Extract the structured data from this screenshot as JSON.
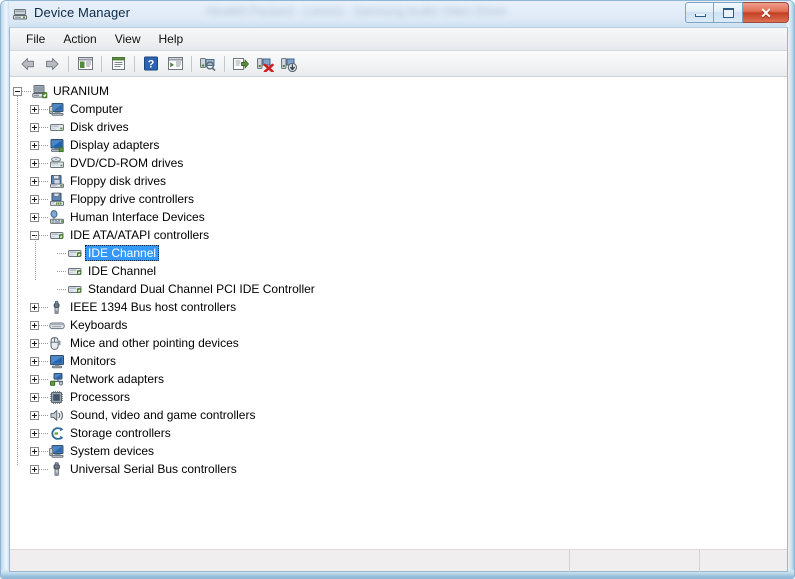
{
  "window": {
    "title": "Device Manager",
    "title_icon": "device-manager-icon",
    "ghost_text": "Hewlett Packard - Lenovo - Samsung Audio Video Driver",
    "controls": {
      "minimize_label": "Minimize",
      "maximize_label": "Maximize",
      "close_label": "✕"
    }
  },
  "menubar": {
    "items": [
      {
        "label": "File"
      },
      {
        "label": "Action"
      },
      {
        "label": "View"
      },
      {
        "label": "Help"
      }
    ]
  },
  "toolbar": {
    "buttons": [
      {
        "name": "back-button",
        "icon": "arrow-left-icon",
        "tooltip": "Back"
      },
      {
        "name": "forward-button",
        "icon": "arrow-right-icon",
        "tooltip": "Forward"
      },
      {
        "name": "show-console-tree-button",
        "icon": "console-tree-icon",
        "tooltip": "Show/Hide Console Tree"
      },
      {
        "name": "properties-button",
        "icon": "properties-icon",
        "tooltip": "Properties"
      },
      {
        "name": "help-button",
        "icon": "help-question-icon",
        "tooltip": "Help"
      },
      {
        "name": "show-hidden-devices-button",
        "icon": "pane-view-icon",
        "tooltip": "View"
      },
      {
        "name": "scan-hardware-changes-button",
        "icon": "scan-hardware-icon",
        "tooltip": "Scan for hardware changes"
      },
      {
        "name": "update-driver-button",
        "icon": "update-driver-icon",
        "tooltip": "Update Driver Software"
      },
      {
        "name": "uninstall-device-button",
        "icon": "uninstall-device-icon",
        "tooltip": "Uninstall"
      },
      {
        "name": "disable-device-button",
        "icon": "disable-device-icon",
        "tooltip": "Disable"
      }
    ]
  },
  "tree": {
    "root": {
      "label": "URANIUM",
      "icon": "computer-root-icon",
      "expanded": true
    },
    "nodes": [
      {
        "label": "Computer",
        "icon": "computer-icon",
        "level": 1,
        "expandable": true,
        "expanded": false,
        "selected": false
      },
      {
        "label": "Disk drives",
        "icon": "disk-drive-icon",
        "level": 1,
        "expandable": true,
        "expanded": false,
        "selected": false
      },
      {
        "label": "Display adapters",
        "icon": "display-adapter-icon",
        "level": 1,
        "expandable": true,
        "expanded": false,
        "selected": false
      },
      {
        "label": "DVD/CD-ROM drives",
        "icon": "dvd-drive-icon",
        "level": 1,
        "expandable": true,
        "expanded": false,
        "selected": false
      },
      {
        "label": "Floppy disk drives",
        "icon": "floppy-disk-icon",
        "level": 1,
        "expandable": true,
        "expanded": false,
        "selected": false
      },
      {
        "label": "Floppy drive controllers",
        "icon": "floppy-ctrl-icon",
        "level": 1,
        "expandable": true,
        "expanded": false,
        "selected": false
      },
      {
        "label": "Human Interface Devices",
        "icon": "hid-icon",
        "level": 1,
        "expandable": true,
        "expanded": false,
        "selected": false
      },
      {
        "label": "IDE ATA/ATAPI controllers",
        "icon": "ide-controller-icon",
        "level": 1,
        "expandable": true,
        "expanded": true,
        "selected": false
      },
      {
        "label": "IDE Channel",
        "icon": "ide-channel-icon",
        "level": 2,
        "expandable": false,
        "expanded": false,
        "selected": true
      },
      {
        "label": "IDE Channel",
        "icon": "ide-channel-icon",
        "level": 2,
        "expandable": false,
        "expanded": false,
        "selected": false
      },
      {
        "label": "Standard Dual Channel PCI IDE Controller",
        "icon": "ide-channel-icon",
        "level": 2,
        "expandable": false,
        "expanded": false,
        "selected": false
      },
      {
        "label": "IEEE 1394 Bus host controllers",
        "icon": "ieee1394-icon",
        "level": 1,
        "expandable": true,
        "expanded": false,
        "selected": false
      },
      {
        "label": "Keyboards",
        "icon": "keyboard-icon",
        "level": 1,
        "expandable": true,
        "expanded": false,
        "selected": false
      },
      {
        "label": "Mice and other pointing devices",
        "icon": "mouse-icon",
        "level": 1,
        "expandable": true,
        "expanded": false,
        "selected": false
      },
      {
        "label": "Monitors",
        "icon": "monitor-icon",
        "level": 1,
        "expandable": true,
        "expanded": false,
        "selected": false
      },
      {
        "label": "Network adapters",
        "icon": "network-adapter-icon",
        "level": 1,
        "expandable": true,
        "expanded": false,
        "selected": false
      },
      {
        "label": "Processors",
        "icon": "processor-icon",
        "level": 1,
        "expandable": true,
        "expanded": false,
        "selected": false
      },
      {
        "label": "Sound, video and game controllers",
        "icon": "sound-icon",
        "level": 1,
        "expandable": true,
        "expanded": false,
        "selected": false
      },
      {
        "label": "Storage controllers",
        "icon": "storage-ctrl-icon",
        "level": 1,
        "expandable": true,
        "expanded": false,
        "selected": false
      },
      {
        "label": "System devices",
        "icon": "system-device-icon",
        "level": 1,
        "expandable": true,
        "expanded": false,
        "selected": false
      },
      {
        "label": "Universal Serial Bus controllers",
        "icon": "usb-icon",
        "level": 1,
        "expandable": true,
        "expanded": false,
        "selected": false
      }
    ]
  },
  "statusbar": {
    "panes": [
      {
        "text": ""
      },
      {
        "text": ""
      },
      {
        "text": ""
      }
    ]
  },
  "colors": {
    "selection_blue": "#3399ff",
    "close_red": "#c53f22",
    "frame_blue": "#8fb6d4",
    "tree_text": "#000000"
  }
}
